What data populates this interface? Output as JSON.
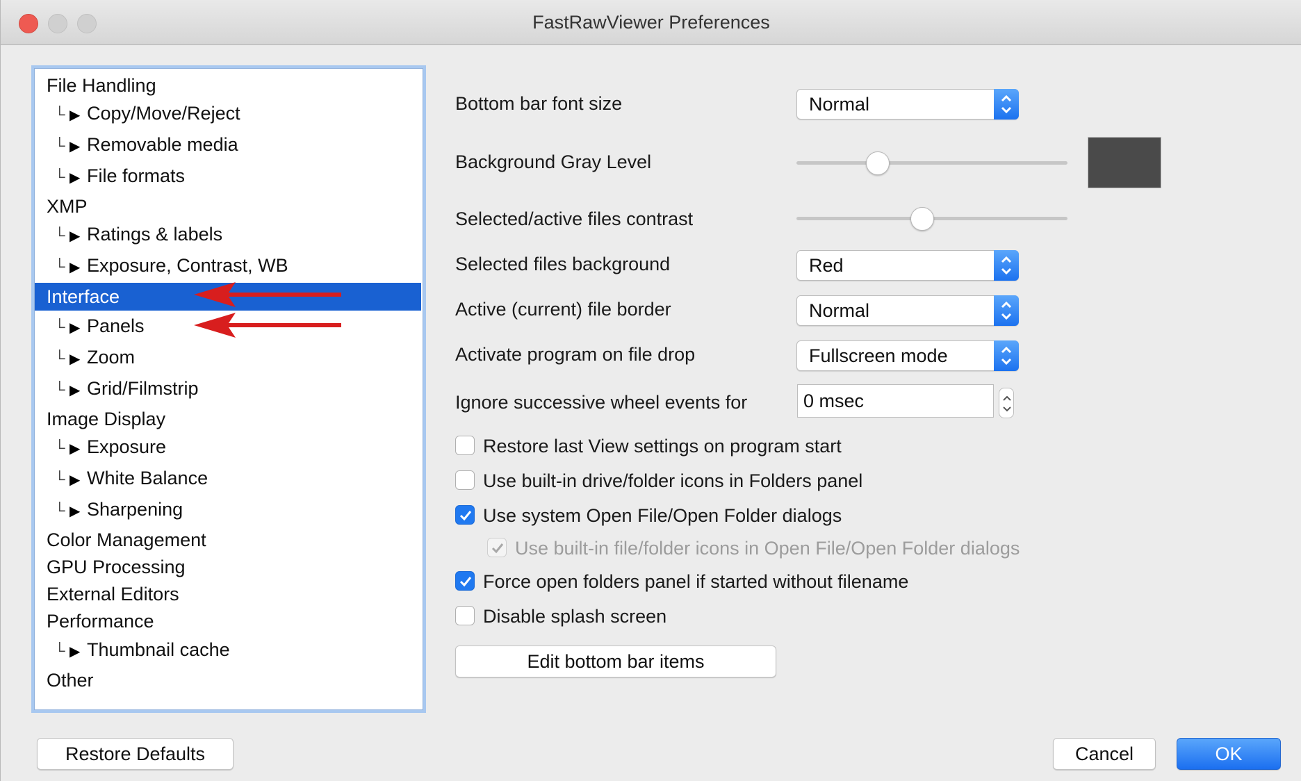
{
  "window": {
    "title": "FastRawViewer Preferences"
  },
  "nav": {
    "items": [
      {
        "label": "File Handling",
        "level": "top"
      },
      {
        "label": "Copy/Move/Reject",
        "level": "sub"
      },
      {
        "label": "Removable media",
        "level": "sub"
      },
      {
        "label": "File formats",
        "level": "sub"
      },
      {
        "label": "XMP",
        "level": "top"
      },
      {
        "label": "Ratings & labels",
        "level": "sub"
      },
      {
        "label": "Exposure, Contrast, WB",
        "level": "sub"
      },
      {
        "label": "Interface",
        "level": "top",
        "selected": true
      },
      {
        "label": "Panels",
        "level": "sub"
      },
      {
        "label": "Zoom",
        "level": "sub"
      },
      {
        "label": "Grid/Filmstrip",
        "level": "sub"
      },
      {
        "label": "Image Display",
        "level": "top"
      },
      {
        "label": "Exposure",
        "level": "sub"
      },
      {
        "label": "White Balance",
        "level": "sub"
      },
      {
        "label": "Sharpening",
        "level": "sub"
      },
      {
        "label": "Color Management",
        "level": "top"
      },
      {
        "label": "GPU Processing",
        "level": "top"
      },
      {
        "label": "External Editors",
        "level": "top"
      },
      {
        "label": "Performance",
        "level": "top"
      },
      {
        "label": "Thumbnail cache",
        "level": "sub"
      },
      {
        "label": "Other",
        "level": "top"
      }
    ],
    "branch_glyph": "└",
    "expand_glyph": "▶"
  },
  "settings": {
    "bottom_bar_font_size": {
      "label": "Bottom bar font size",
      "value": "Normal"
    },
    "background_gray_level": {
      "label": "Background Gray Level",
      "value": 0.28,
      "swatch_color": "#4a4a4a"
    },
    "selected_contrast": {
      "label": "Selected/active files contrast",
      "value": 0.46
    },
    "selected_background": {
      "label": "Selected files background",
      "value": "Red"
    },
    "active_border": {
      "label": "Active (current) file border",
      "value": "Normal"
    },
    "activate_on_drop": {
      "label": "Activate program on file drop",
      "value": "Fullscreen mode"
    },
    "ignore_wheel": {
      "label": "Ignore successive wheel events for",
      "value": "0 msec"
    }
  },
  "checkboxes": [
    {
      "label": "Restore last View settings on program start",
      "checked": false,
      "disabled": false
    },
    {
      "label": "Use built-in drive/folder icons in Folders panel",
      "checked": false,
      "disabled": false
    },
    {
      "label": "Use system Open File/Open Folder dialogs",
      "checked": true,
      "disabled": false
    },
    {
      "label": "Use built-in file/folder icons in Open File/Open Folder dialogs",
      "checked": true,
      "disabled": true
    },
    {
      "label": "Force open folders panel if started without filename",
      "checked": true,
      "disabled": false
    },
    {
      "label": "Disable splash screen",
      "checked": false,
      "disabled": false
    }
  ],
  "buttons": {
    "edit_bottom_bar": "Edit bottom bar items",
    "restore_defaults": "Restore Defaults",
    "cancel": "Cancel",
    "ok": "OK"
  },
  "colors": {
    "accent": "#1b6ff0",
    "selection": "#1961d2",
    "annotation_arrow": "#d81e1e",
    "close_light": "#ee5a52"
  },
  "icons": {
    "popup_stepper": "chevron-up-down-icon",
    "annotation": "red-arrow-icon"
  }
}
